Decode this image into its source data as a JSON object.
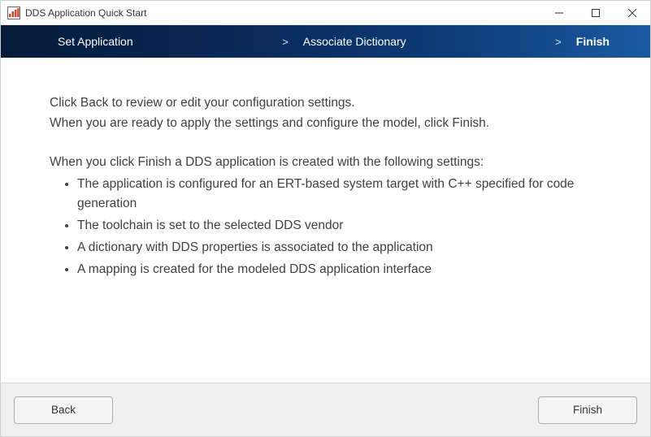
{
  "window": {
    "title": "DDS Application Quick Start"
  },
  "steps": {
    "set_application": "Set Application",
    "associate_dictionary": "Associate Dictionary",
    "finish": "Finish",
    "separator": ">"
  },
  "content": {
    "line1": "Click Back to review or edit your configuration settings.",
    "line2": "When you are ready to apply the settings and configure the model, click Finish.",
    "line3": "When you click Finish a DDS application is created with the following settings:",
    "bullets": {
      "b1": "The application is configured for an ERT-based system target with C++ specified for code generation",
      "b2": "The toolchain is set to the selected DDS vendor",
      "b3": "A dictionary with DDS properties is associated to the application",
      "b4": "A mapping is created for the modeled DDS application interface"
    }
  },
  "buttons": {
    "back": "Back",
    "finish": "Finish"
  }
}
